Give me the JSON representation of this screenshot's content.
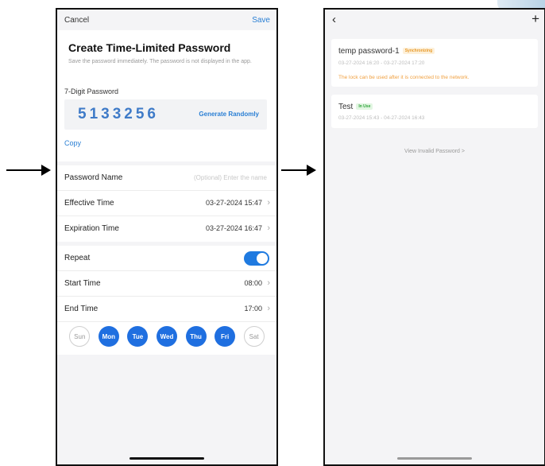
{
  "left_screen": {
    "cancel_label": "Cancel",
    "save_label": "Save",
    "title": "Create Time-Limited Password",
    "note": "Save the password immediately. The password is not displayed in the app.",
    "password_label": "7-Digit Password",
    "password_digits": "5133256",
    "generate_label": "Generate Randomly",
    "copy_label": "Copy",
    "password_name_label": "Password Name",
    "password_name_placeholder": "(Optional) Enter the name",
    "effective_time_label": "Effective Time",
    "effective_time_value": "03-27-2024 15:47",
    "expiration_time_label": "Expiration Time",
    "expiration_time_value": "03-27-2024 16:47",
    "repeat_label": "Repeat",
    "repeat_on": true,
    "start_time_label": "Start Time",
    "start_time_value": "08:00",
    "end_time_label": "End Time",
    "end_time_value": "17:00",
    "days": [
      {
        "label": "Sun",
        "selected": false
      },
      {
        "label": "Mon",
        "selected": true
      },
      {
        "label": "Tue",
        "selected": true
      },
      {
        "label": "Wed",
        "selected": true
      },
      {
        "label": "Thu",
        "selected": true
      },
      {
        "label": "Fri",
        "selected": true
      },
      {
        "label": "Sat",
        "selected": false
      }
    ]
  },
  "right_screen": {
    "back_icon": "chevron-left-icon",
    "add_icon": "plus-icon",
    "passwords": [
      {
        "name": "temp password-1",
        "status": "Synchronizing",
        "range": "03-27-2024 16:20 - 03-27-2024 17:20",
        "warning": "The lock can be used after it is connected to the network."
      },
      {
        "name": "Test",
        "status": "In Use",
        "range": "03-27-2024 15:43 - 04-27-2024 16:43"
      }
    ],
    "invalid_link": "View Invalid Password >"
  },
  "colors": {
    "accent": "#1f7ae0",
    "link": "#2a7fd4",
    "warning": "#f0a040",
    "in_use": "#2ea43a"
  }
}
